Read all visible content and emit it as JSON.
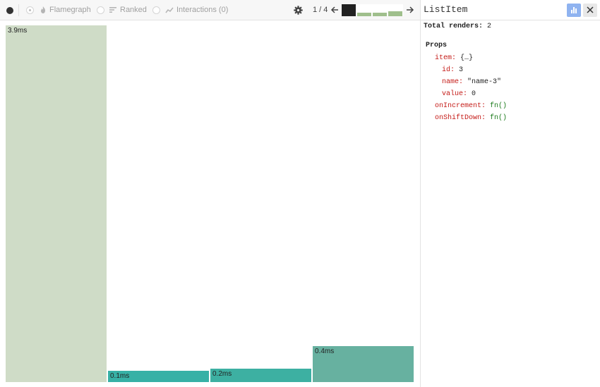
{
  "toolbar": {
    "modes": [
      {
        "label": "Flamegraph",
        "icon": "flame-icon"
      },
      {
        "label": "Ranked",
        "icon": "ranked-icon"
      },
      {
        "label": "Interactions (0)",
        "icon": "interactions-icon"
      }
    ],
    "pager": "1 / 4",
    "commits": [
      {
        "selected": true,
        "level": 1.0
      },
      {
        "selected": false,
        "level": 0.3
      },
      {
        "selected": false,
        "level": 0.3
      },
      {
        "selected": false,
        "level": 0.4
      }
    ]
  },
  "graph": {
    "bars": [
      {
        "label": "3.9ms",
        "color": "#cfdcc7"
      },
      {
        "label": "0.1ms",
        "color": "#37b1a6"
      },
      {
        "label": "0.2ms",
        "color": "#3db0a2"
      },
      {
        "label": "0.4ms",
        "color": "#67b1a0"
      }
    ]
  },
  "detail": {
    "component_name": "ListItem",
    "total_renders_label": "Total renders:",
    "total_renders_value": "2",
    "props_title": "Props",
    "props": [
      {
        "key": "item:",
        "value": "{…}",
        "kind": "object",
        "indent": 0
      },
      {
        "key": "id:",
        "value": "3",
        "kind": "value",
        "indent": 1
      },
      {
        "key": "name:",
        "value": "\"name-3\"",
        "kind": "value",
        "indent": 1
      },
      {
        "key": "value:",
        "value": "0",
        "kind": "value",
        "indent": 1
      },
      {
        "key": "onIncrement:",
        "value": "fn()",
        "kind": "fn",
        "indent": 0
      },
      {
        "key": "onShiftDown:",
        "value": "fn()",
        "kind": "fn",
        "indent": 0
      }
    ]
  },
  "colors": {
    "accent": "#8fb3f0",
    "prop_key": "#c41a16",
    "fn_value": "#1a7a1a",
    "commit_selected": "#222222",
    "commit_other": "#9fbf8c"
  }
}
